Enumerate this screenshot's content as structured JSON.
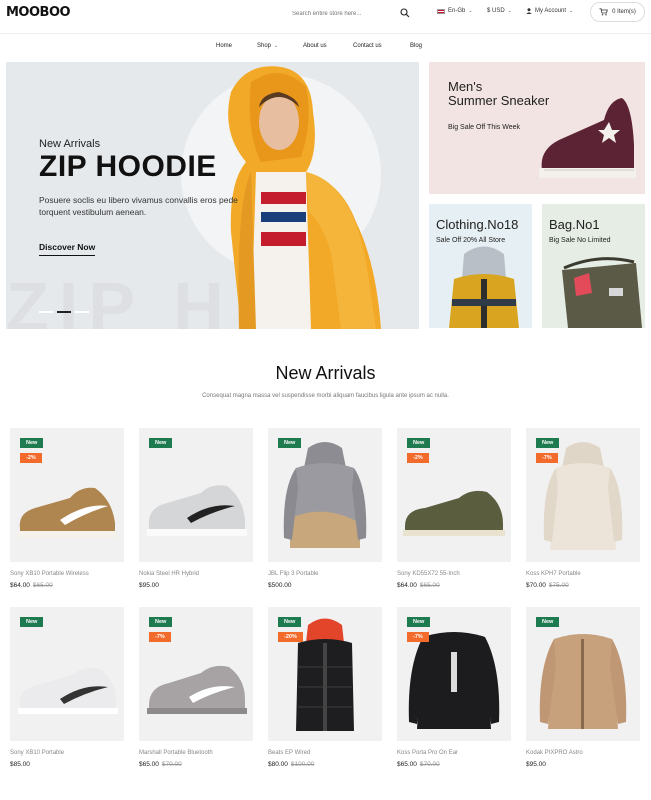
{
  "header": {
    "logo": "MOOBOO",
    "search_placeholder": "Search entire store here...",
    "language": "En-Gb",
    "currency": "$ USD",
    "account": "My Account",
    "cart": "0 Item(s)"
  },
  "nav": {
    "items": [
      "Home",
      "Shop",
      "About us",
      "Contact us",
      "Blog"
    ]
  },
  "hero": {
    "eyebrow": "New Arrivals",
    "title": "ZIP HOODIE",
    "description": "Posuere soclis eu libero vivamus convallis eros pede torquent vestibulum aenean.",
    "cta": "Discover Now",
    "ghost_text": "ZIP H"
  },
  "banners": [
    {
      "title_line1": "Men's",
      "title_line2": "Summer Sneaker",
      "subtitle": "Big Sale Off This Week"
    },
    {
      "title": "Clothing.No18",
      "subtitle": "Sale Off 20% All Store"
    },
    {
      "title": "Bag.No1",
      "subtitle": "Big Sale No Limited"
    }
  ],
  "section": {
    "title": "New Arrivals",
    "subtitle": "Consequat magna massa vel suspendisse morbi aliquam faucibus ligula ante ipsum ac nulla."
  },
  "products": [
    {
      "name": "Sony XB10 Portable Wireless",
      "price": "$64.00",
      "old_price": "$65.00",
      "badge_new": "New",
      "badge_sale": "-2%"
    },
    {
      "name": "Nokia Steel HR Hybrid",
      "price": "$95.00",
      "old_price": "",
      "badge_new": "New",
      "badge_sale": ""
    },
    {
      "name": "JBL Flip 3 Portable",
      "price": "$500.00",
      "old_price": "",
      "badge_new": "New",
      "badge_sale": ""
    },
    {
      "name": "Sony KD55X72 55-Inch",
      "price": "$64.00",
      "old_price": "$65.00",
      "badge_new": "New",
      "badge_sale": "-2%"
    },
    {
      "name": "Koss KPH7 Portable",
      "price": "$70.00",
      "old_price": "$75.00",
      "badge_new": "New",
      "badge_sale": "-7%"
    },
    {
      "name": "Sony XB10 Portable",
      "price": "$85.00",
      "old_price": "",
      "badge_new": "New",
      "badge_sale": ""
    },
    {
      "name": "Marshall Portable Bluetooth",
      "price": "$65.00",
      "old_price": "$70.00",
      "badge_new": "New",
      "badge_sale": "-7%"
    },
    {
      "name": "Beats EP Wired",
      "price": "$80.00",
      "old_price": "$100.00",
      "badge_new": "New",
      "badge_sale": "-20%"
    },
    {
      "name": "Koss Porta Pro On Ear",
      "price": "$65.00",
      "old_price": "$70.00",
      "badge_new": "New",
      "badge_sale": "-7%"
    },
    {
      "name": "Kodak PIXPRO Astro",
      "price": "$95.00",
      "old_price": "",
      "badge_new": "New",
      "badge_sale": ""
    }
  ],
  "colors": {
    "badge_new": "#1e7a4f",
    "badge_sale": "#f26b2b",
    "hero_bg": "#e6e9ec",
    "hoodie": "#f5a623"
  }
}
